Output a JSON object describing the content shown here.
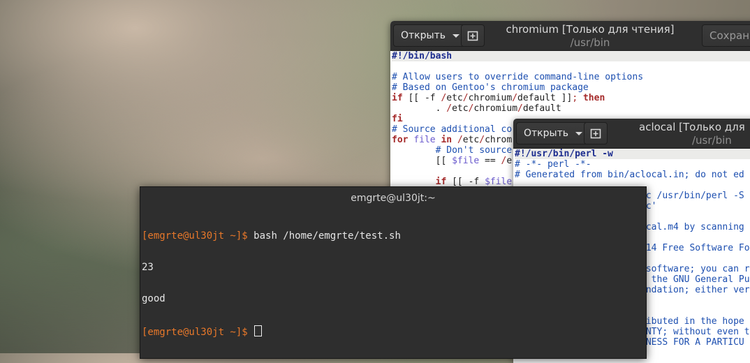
{
  "editor1": {
    "open_label": "Открыть",
    "title": "chromium [Только для чтения]",
    "subtitle": "/usr/bin",
    "save_label": "Сохрани",
    "lines": [
      [
        {
          "t": "#!/bin/bash",
          "c": "sb"
        }
      ],
      [],
      [
        {
          "t": "# Allow users to override command-line options",
          "c": "cm"
        }
      ],
      [
        {
          "t": "# Based on Gentoo's chromium package",
          "c": "cm"
        }
      ],
      [
        {
          "t": "if",
          "c": "kw"
        },
        {
          "t": " [[ -f "
        },
        {
          "t": "/",
          "c": "pu"
        },
        {
          "t": "etc"
        },
        {
          "t": "/",
          "c": "pu"
        },
        {
          "t": "chromium"
        },
        {
          "t": "/",
          "c": "pu"
        },
        {
          "t": "default ]]"
        },
        {
          "t": "; ",
          "c": "pu"
        },
        {
          "t": "then",
          "c": "kw"
        }
      ],
      [
        {
          "t": "        . "
        },
        {
          "t": "/",
          "c": "pu"
        },
        {
          "t": "etc"
        },
        {
          "t": "/",
          "c": "pu"
        },
        {
          "t": "chromium"
        },
        {
          "t": "/",
          "c": "pu"
        },
        {
          "t": "default"
        }
      ],
      [
        {
          "t": "fi",
          "c": "kw"
        }
      ],
      [
        {
          "t": "# Source additional co",
          "c": "cm"
        }
      ],
      [
        {
          "t": "for",
          "c": "kw"
        },
        {
          "t": " "
        },
        {
          "t": "file",
          "c": "var"
        },
        {
          "t": " "
        },
        {
          "t": "in",
          "c": "kw"
        },
        {
          "t": " "
        },
        {
          "t": "/",
          "c": "pu"
        },
        {
          "t": "etc"
        },
        {
          "t": "/",
          "c": "pu"
        },
        {
          "t": "chrom"
        }
      ],
      [
        {
          "t": "        "
        },
        {
          "t": "# Don't source",
          "c": "cm"
        }
      ],
      [
        {
          "t": "        [[ "
        },
        {
          "t": "$file",
          "c": "var"
        },
        {
          "t": " == "
        },
        {
          "t": "/",
          "c": "pu"
        },
        {
          "t": "e"
        }
      ],
      [],
      [
        {
          "t": "        "
        },
        {
          "t": "if",
          "c": "kw"
        },
        {
          "t": " [[ -f "
        },
        {
          "t": "$file",
          "c": "var"
        }
      ]
    ]
  },
  "editor2": {
    "open_label": "Открыть",
    "title": "aclocal [Только для",
    "subtitle": "/usr/bin",
    "lines": [
      [
        {
          "t": "#!/usr/bin/perl -w",
          "c": "sb"
        }
      ],
      [
        {
          "t": "# -*- perl -*-",
          "c": "cm"
        }
      ],
      [
        {
          "t": "# Generated from bin/aclocal.in; do not ed",
          "c": "cm"
        }
      ],
      [],
      [
        {
          "t": "                        c /usr/bin/perl -S",
          "c": "cm"
        }
      ],
      [
        {
          "t": "                        c'",
          "c": "cm"
        }
      ],
      [],
      [
        {
          "t": "                        cal.m4 by scanning",
          "c": "cm"
        }
      ],
      [],
      [
        {
          "t": "                        14 Free Software Fo",
          "c": "cm"
        }
      ],
      [],
      [
        {
          "t": "                        software; you can r",
          "c": "cm"
        }
      ],
      [
        {
          "t": "                         the GNU General Pu",
          "c": "cm"
        }
      ],
      [
        {
          "t": "                        ndation; either ver",
          "c": "cm"
        }
      ],
      [],
      [],
      [
        {
          "t": "                        ibuted in the hope",
          "c": "cm"
        }
      ],
      [
        {
          "t": "                        NTY; without even t",
          "c": "cm"
        }
      ],
      [
        {
          "t": "                        NESS FOR A PARTICU",
          "c": "cm"
        }
      ]
    ]
  },
  "terminal": {
    "title": "emgrte@ul30jt:~",
    "prompt": "[emgrte@ul30jt ~]$ ",
    "command": "bash /home/emgrte/test.sh",
    "output1": "23",
    "output2": "good"
  }
}
